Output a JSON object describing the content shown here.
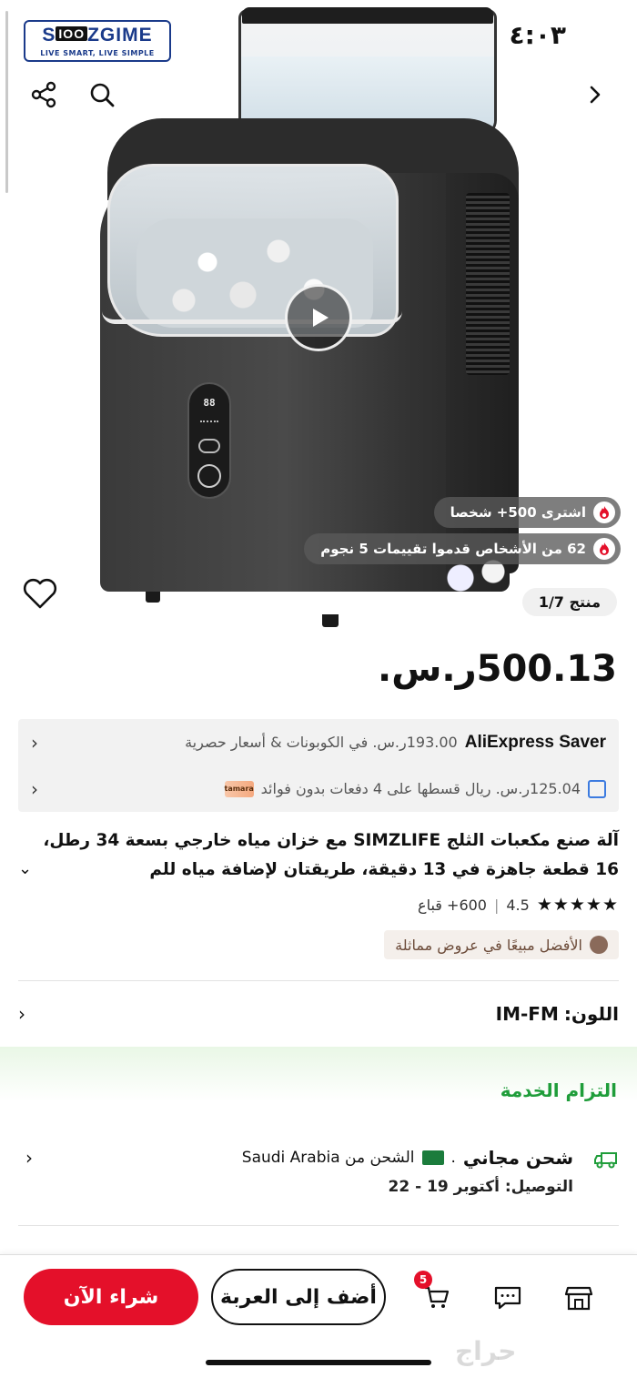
{
  "status": {
    "time": "٤:٠٣"
  },
  "logo": {
    "brand_left": "S",
    "brand_mid": "ΙΟΟ",
    "brand_right": "ZGIME",
    "tagline": "LIVE SMART, LIVE SIMPLE"
  },
  "hero": {
    "purchased_badge": "اشترى 500+ شخصا",
    "reviews_badge": "62 من الأشخاص قدموا تقييمات 5 نجوم",
    "image_counter": "منتج 1/7",
    "panel_display": "88"
  },
  "price": {
    "amount": "500.13",
    "currency": "ر.س."
  },
  "promos": [
    {
      "brand": "AliExpress Saver",
      "text": "193.00ر.س. في الكوبونات & أسعار حصرية"
    },
    {
      "brand": "tamara",
      "text": "125.04ر.س. ريال قسطها على 4 دفعات بدون فوائد"
    }
  ],
  "product": {
    "title": "آلة صنع مكعبات الثلج SIMZLIFE مع خزان مياه خارجي بسعة 34 رطل، 16 قطعة جاهزة في 13 دقيقة، طريقتان لإضافة مياه للم",
    "rating_value": "4.5",
    "review_count": "600",
    "sold": "600+ قباع",
    "stars": "★★★★★",
    "best_seller": "الأفضل مبيعًا في عروض مماثلة"
  },
  "color": {
    "label": "اللون:",
    "value": "IM-FM"
  },
  "service": {
    "title": "التزام الخدمة",
    "shipping_free": "شحن مجاني",
    "shipping_from": "الشحن من Saudi Arabia",
    "delivery": "التوصيل: أكتوبر 19 - 22"
  },
  "bottom_bar": {
    "buy_now": "شراء الآن",
    "add_to_cart": "أضف إلى العربة",
    "cart_count": "5"
  },
  "watermark": "حراج",
  "colors": {
    "accent_red": "#e4102a",
    "service_green": "#1f9d3a"
  }
}
